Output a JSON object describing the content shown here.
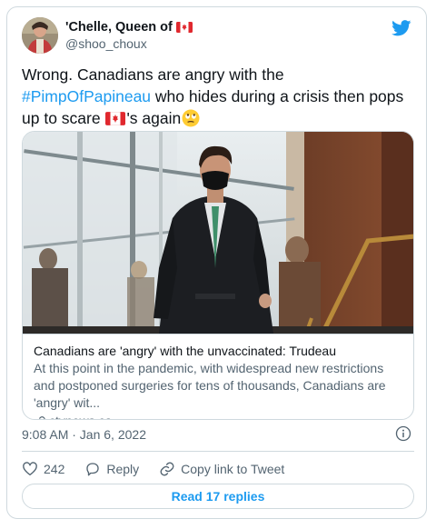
{
  "author": {
    "display_name": "'Chelle, Queen of",
    "handle": "@shoo_choux"
  },
  "tweet": {
    "text_part1": "Wrong. Canadians are angry with the ",
    "hashtag": "#PimpOfPapineau",
    "text_part2": " who hides during a crisis then pops up to scare ",
    "text_part3": "'s again",
    "emoji_face": "🙄"
  },
  "card": {
    "title": "Canadians are 'angry' with the unvaccinated: Trudeau",
    "description": "At this point in the pandemic, with widespread new restrictions and postponed surgeries for tens of thousands, Canadians are 'angry' wit...",
    "domain": "ctvnews.ca"
  },
  "meta": {
    "timestamp": "9:08 AM · Jan 6, 2022"
  },
  "actions": {
    "likes": "242",
    "reply_label": "Reply",
    "copy_label": "Copy link to Tweet"
  },
  "read_replies_label": "Read 17 replies",
  "colors": {
    "accent": "#1d9bf0",
    "like_count_color": "#536471"
  },
  "icons": [
    "twitter-bird-icon",
    "canada-flag-icon",
    "link-icon",
    "info-icon",
    "heart-icon",
    "reply-icon",
    "copy-link-icon"
  ]
}
